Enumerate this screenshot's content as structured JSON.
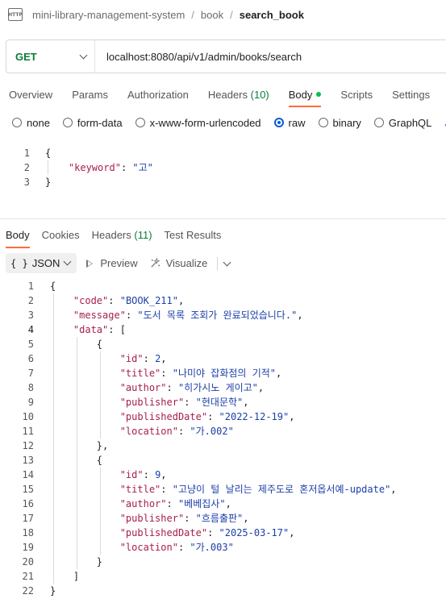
{
  "breadcrumb": {
    "icon": "http-file-icon",
    "icon_text": "HTTP",
    "parts": [
      "mini-library-management-system",
      "book"
    ],
    "current": "search_book"
  },
  "request": {
    "method": "GET",
    "url": "localhost:8080/api/v1/admin/books/search"
  },
  "request_tabs": [
    {
      "label": "Overview"
    },
    {
      "label": "Params"
    },
    {
      "label": "Authorization"
    },
    {
      "label": "Headers",
      "count": "(10)"
    },
    {
      "label": "Body",
      "active": true,
      "indicator": "green-dot"
    },
    {
      "label": "Scripts"
    },
    {
      "label": "Settings"
    }
  ],
  "body_types": [
    "none",
    "form-data",
    "x-www-form-urlencoded",
    "raw",
    "binary",
    "GraphQL"
  ],
  "body_type_selected": "raw",
  "body_type_overflow": "J",
  "request_body_lines": [
    "{",
    "    \"keyword\": \"고\"",
    "}"
  ],
  "response_tabs": [
    {
      "label": "Body",
      "active": true
    },
    {
      "label": "Cookies"
    },
    {
      "label": "Headers",
      "count": "(11)"
    },
    {
      "label": "Test Results"
    }
  ],
  "view_controls": {
    "format_braces": "{ }",
    "format": "JSON",
    "preview": "Preview",
    "visualize": "Visualize"
  },
  "response_json": {
    "code": "BOOK_211",
    "message": "도서 목록 조회가 완료되었습니다.",
    "data": [
      {
        "id": "2",
        "title": "나미야 잡화점의 기적",
        "author": "히가시노 게이고",
        "publisher": "현대문학",
        "publishedDate": "2022-12-19",
        "location": "가.002"
      },
      {
        "id": "9",
        "title": "고냥이 털 날리는 제주도로 혼저옵서예-update",
        "author": "베베집사",
        "publisher": "흐름출판",
        "publishedDate": "2025-03-17",
        "location": "가.003"
      }
    ]
  },
  "colors": {
    "method": "#0a7d3b",
    "accent": "#ff6c37",
    "active_dot": "#0cbb52",
    "radio_selected": "#0b5cd5",
    "json_key": "#a61f4b",
    "json_value": "#1c3fa8"
  }
}
